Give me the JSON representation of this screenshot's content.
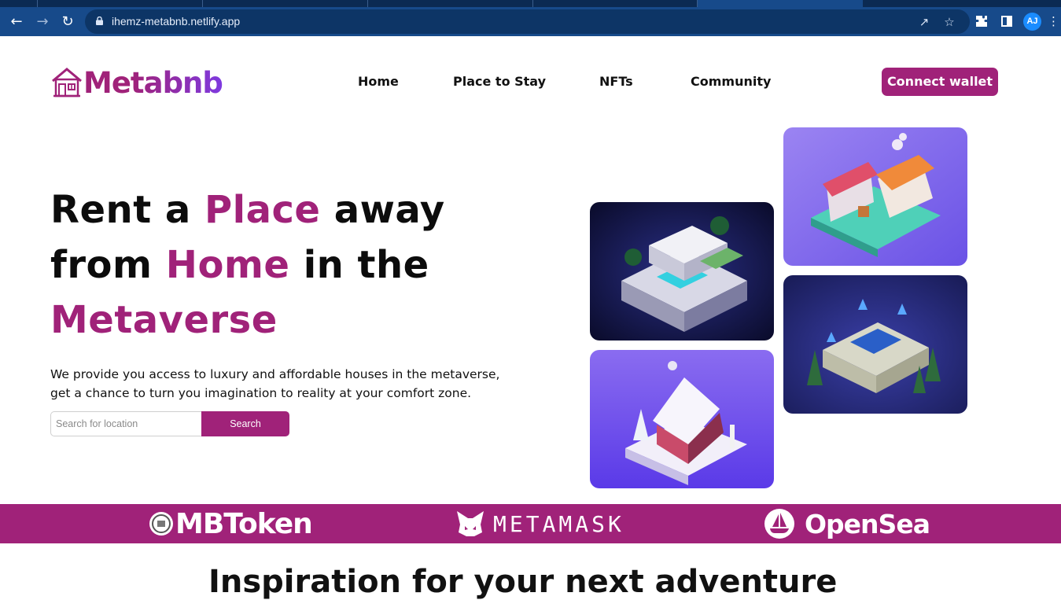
{
  "browser": {
    "url": "ihemz-metabnb.netlify.app",
    "profile_initials": "AJ"
  },
  "site": {
    "logo_text": "Metabnb",
    "nav": [
      {
        "label": "Home"
      },
      {
        "label": "Place to Stay"
      },
      {
        "label": "NFTs"
      },
      {
        "label": "Community"
      }
    ],
    "connect_label": "Connect wallet"
  },
  "hero": {
    "title_parts": [
      "Rent a ",
      "Place",
      " away",
      "from ",
      "Home",
      " in the",
      "Metaverse"
    ],
    "description_line1": "We provide you access to luxury and affordable houses in the metaverse,",
    "description_line2": "get a chance to turn you imagination to reality at your comfort zone.",
    "search_placeholder": "Search for location",
    "search_button": "Search"
  },
  "partners": [
    {
      "name": "MBToken",
      "icon": "mbtoken-coin-icon"
    },
    {
      "name": "METAMASK",
      "icon": "metamask-fox-icon"
    },
    {
      "name": "OpenSea",
      "icon": "opensea-boat-icon"
    }
  ],
  "next_section_heading": "Inspiration for your next adventure",
  "colors": {
    "brand": "#a02279",
    "browser_bar": "#174a8a",
    "text": "#0c0c0c"
  }
}
